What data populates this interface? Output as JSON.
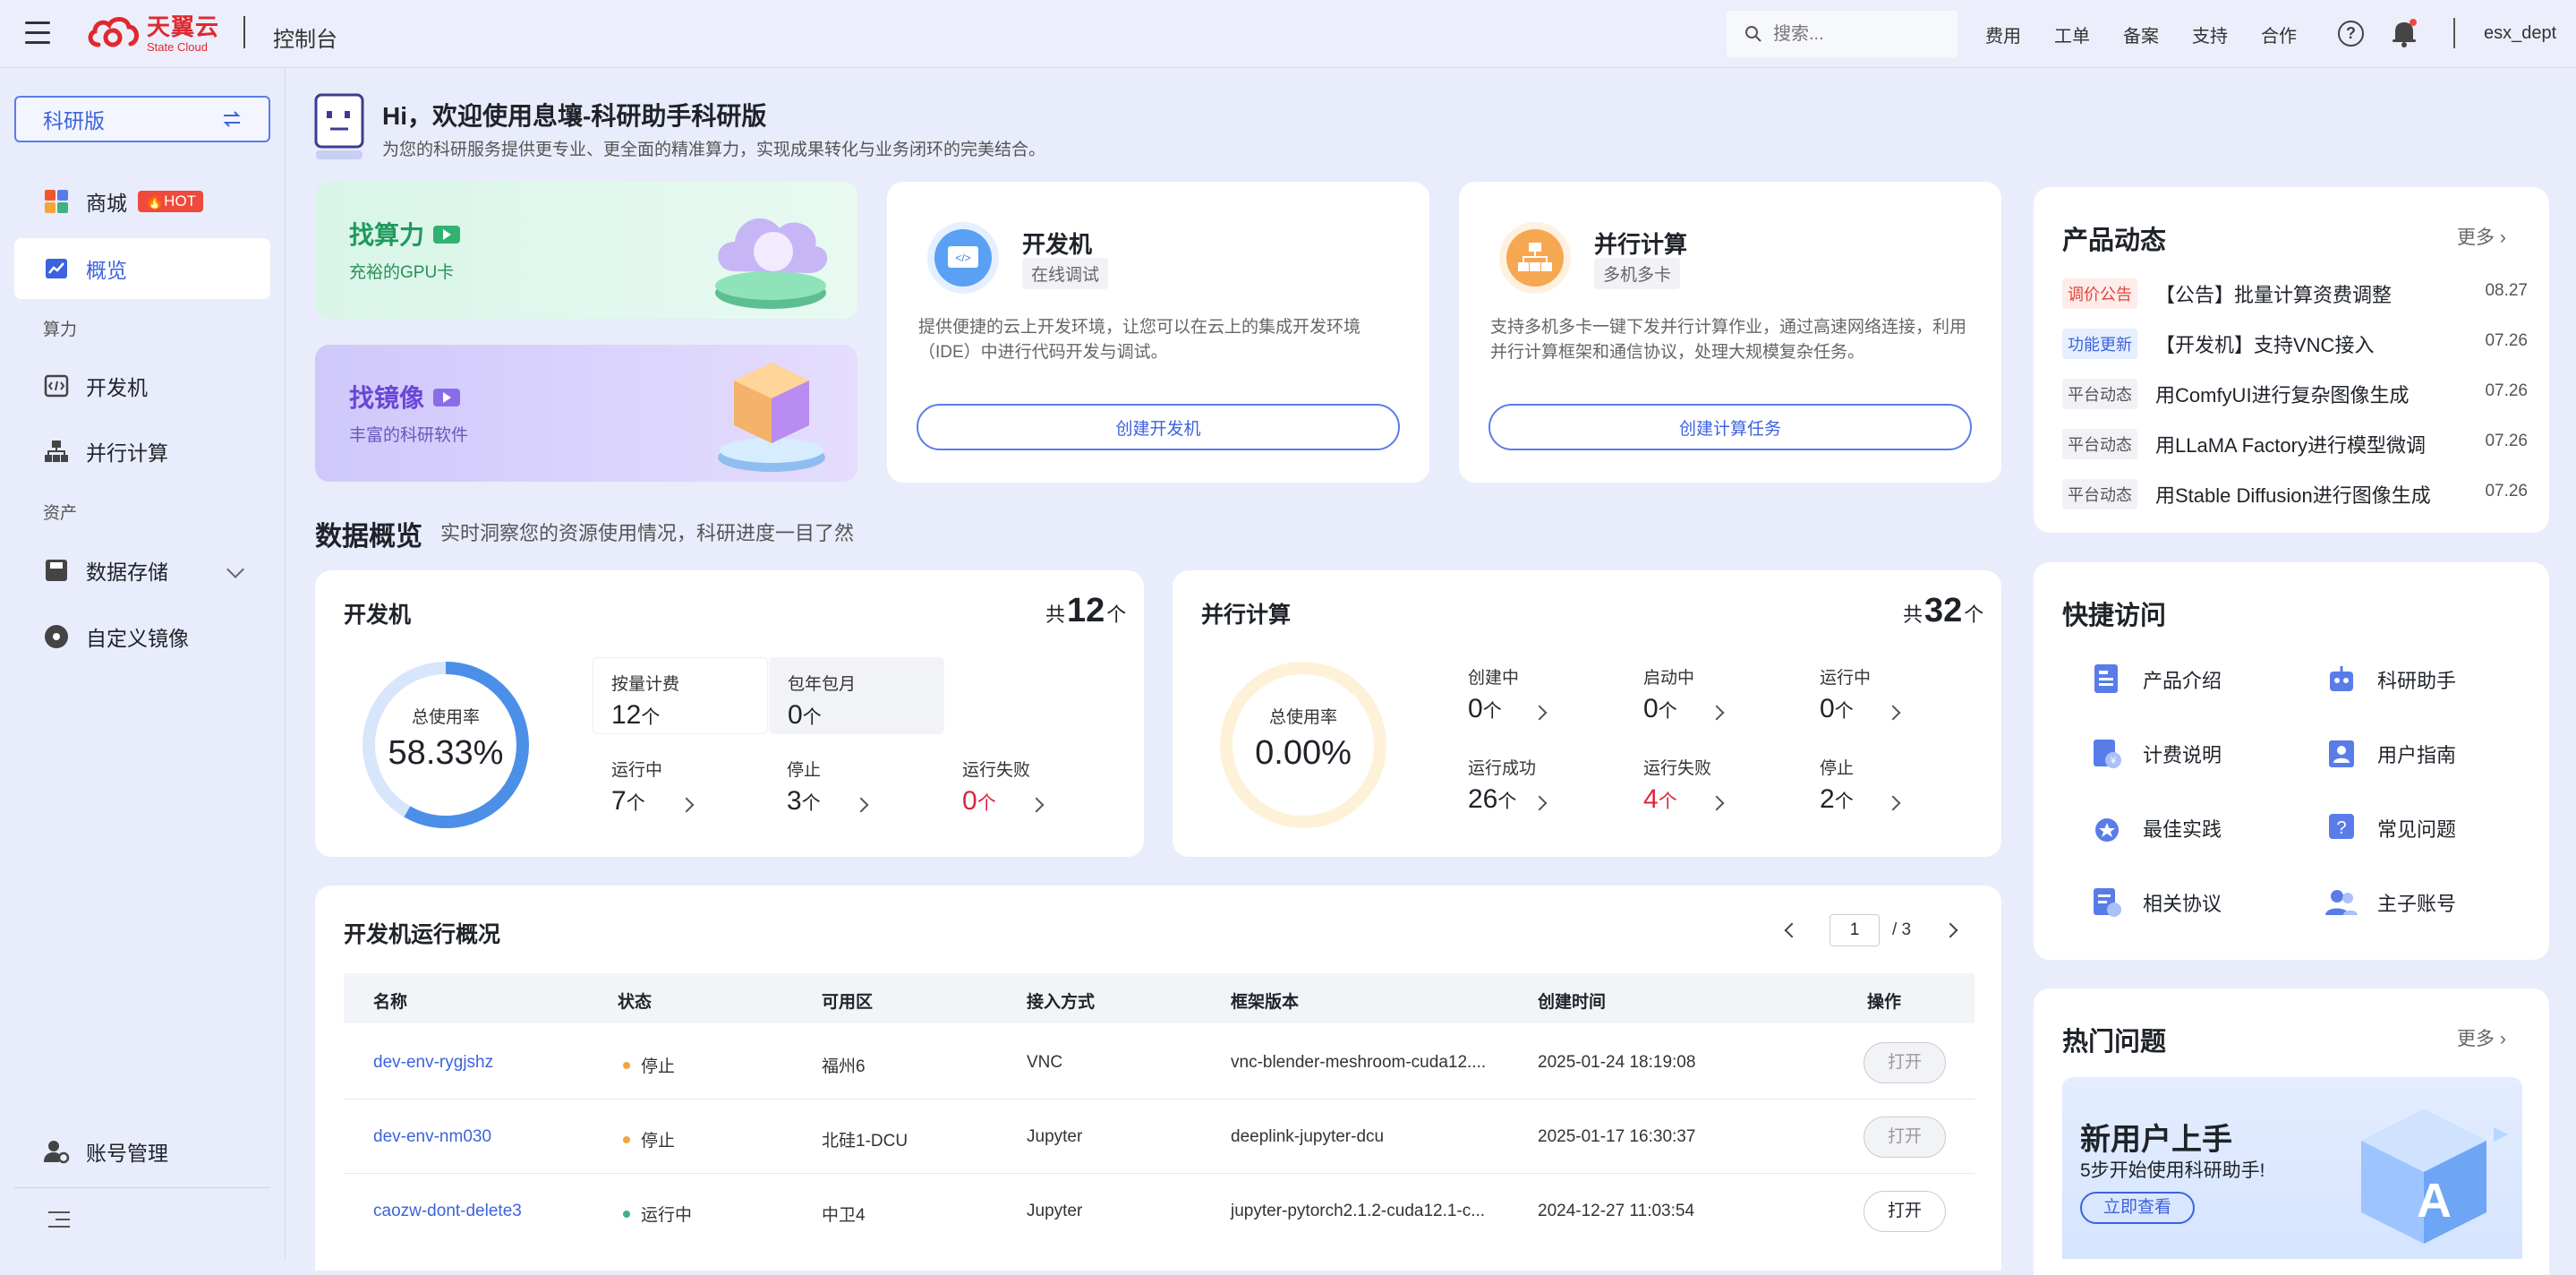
{
  "topbar": {
    "logo_cn": "天翼云",
    "logo_en": "State Cloud",
    "console_title": "控制台",
    "search_placeholder": "搜索...",
    "links": [
      "费用",
      "工单",
      "备案",
      "支持",
      "合作"
    ],
    "help_icon": "help-icon",
    "bell_icon": "bell-icon",
    "user": "esx_dept"
  },
  "sidebar": {
    "edition": "科研版",
    "items": [
      {
        "label": "商城",
        "badge": "HOT",
        "icon": "store-icon"
      },
      {
        "label": "概览",
        "icon": "overview-icon",
        "active": true
      },
      {
        "group": "算力"
      },
      {
        "label": "开发机",
        "icon": "devbox-icon"
      },
      {
        "label": "并行计算",
        "icon": "parallel-icon"
      },
      {
        "group": "资产"
      },
      {
        "label": "数据存储",
        "icon": "storage-icon",
        "expandable": true
      },
      {
        "label": "自定义镜像",
        "icon": "image-icon"
      }
    ],
    "account": "账号管理"
  },
  "welcome": {
    "title": "Hi，欢迎使用息壤-科研助手科研版",
    "subtitle": "为您的科研服务提供更专业、更全面的精准算力，实现成果转化与业务闭环的完美结合。"
  },
  "promos": [
    {
      "title": "找算力",
      "sub": "充裕的GPU卡"
    },
    {
      "title": "找镜像",
      "sub": "丰富的科研软件"
    }
  ],
  "services": [
    {
      "title": "开发机",
      "tag": "在线调试",
      "desc": "提供便捷的云上开发环境，让您可以在云上的集成开发环境（IDE）中进行代码开发与调试。",
      "button": "创建开发机"
    },
    {
      "title": "并行计算",
      "tag": "多机多卡",
      "desc": "支持多机多卡一键下发并行计算作业，通过高速网络连接，利用并行计算框架和通信协议，处理大规模复杂任务。",
      "button": "创建计算任务"
    }
  ],
  "overview": {
    "title": "数据概览",
    "subtitle": "实时洞察您的资源使用情况，科研进度一目了然",
    "devbox": {
      "title": "开发机",
      "total_prefix": "共",
      "total": "12",
      "unit": "个",
      "ring_label": "总使用率",
      "usage": "58.33%",
      "usage_fraction": 0.5833,
      "pay": [
        {
          "label": "按量计费",
          "value": "12"
        },
        {
          "label": "包年包月",
          "value": "0"
        }
      ],
      "states": [
        {
          "label": "运行中",
          "value": "7"
        },
        {
          "label": "停止",
          "value": "3"
        },
        {
          "label": "运行失败",
          "value": "0"
        }
      ]
    },
    "parallel": {
      "title": "并行计算",
      "total_prefix": "共",
      "total": "32",
      "unit": "个",
      "ring_label": "总使用率",
      "usage": "0.00%",
      "usage_fraction": 0,
      "states": [
        {
          "label": "创建中",
          "value": "0"
        },
        {
          "label": "启动中",
          "value": "0"
        },
        {
          "label": "运行中",
          "value": "0"
        },
        {
          "label": "运行成功",
          "value": "26"
        },
        {
          "label": "运行失败",
          "value": "4"
        },
        {
          "label": "停止",
          "value": "2"
        }
      ]
    }
  },
  "table": {
    "title": "开发机运行概况",
    "page": "1",
    "page_total": "/ 3",
    "headers": [
      "名称",
      "状态",
      "可用区",
      "接入方式",
      "框架版本",
      "创建时间",
      "操作"
    ],
    "rows": [
      {
        "name": "dev-env-rygjshz",
        "status": "停止",
        "zone": "福州6",
        "access": "VNC",
        "framework": "vnc-blender-meshroom-cuda12....",
        "created": "2025-01-24 18:19:08",
        "action": "打开"
      },
      {
        "name": "dev-env-nm030",
        "status": "停止",
        "zone": "北硅1-DCU",
        "access": "Jupyter",
        "framework": "deeplink-jupyter-dcu",
        "created": "2025-01-17 16:30:37",
        "action": "打开"
      },
      {
        "name": "caozw-dont-delete3",
        "status": "运行中",
        "zone": "中卫4",
        "access": "Jupyter",
        "framework": "jupyter-pytorch2.1.2-cuda12.1-c...",
        "created": "2024-12-27 11:03:54",
        "action": "打开"
      }
    ]
  },
  "news": {
    "title": "产品动态",
    "more": "更多",
    "items": [
      {
        "tag": "调价公告",
        "text": "【公告】批量计算资费调整",
        "date": "08.27"
      },
      {
        "tag": "功能更新",
        "text": "【开发机】支持VNC接入",
        "date": "07.26"
      },
      {
        "tag": "平台动态",
        "text": "用ComfyUI进行复杂图像生成",
        "date": "07.26"
      },
      {
        "tag": "平台动态",
        "text": "用LLaMA Factory进行模型微调",
        "date": "07.26"
      },
      {
        "tag": "平台动态",
        "text": "用Stable Diffusion进行图像生成",
        "date": "07.26"
      }
    ]
  },
  "quick": {
    "title": "快捷访问",
    "items": [
      "产品介绍",
      "科研助手",
      "计费说明",
      "用户指南",
      "最佳实践",
      "常见问题",
      "相关协议",
      "主子账号"
    ]
  },
  "faq": {
    "title": "热门问题",
    "more": "更多",
    "banner_title": "新用户上手",
    "banner_sub": "5步开始使用科研助手!",
    "banner_button": "立即查看"
  },
  "colors": {
    "accent": "#3c62de",
    "danger": "#d9263b",
    "hot": "#f04a3d"
  }
}
